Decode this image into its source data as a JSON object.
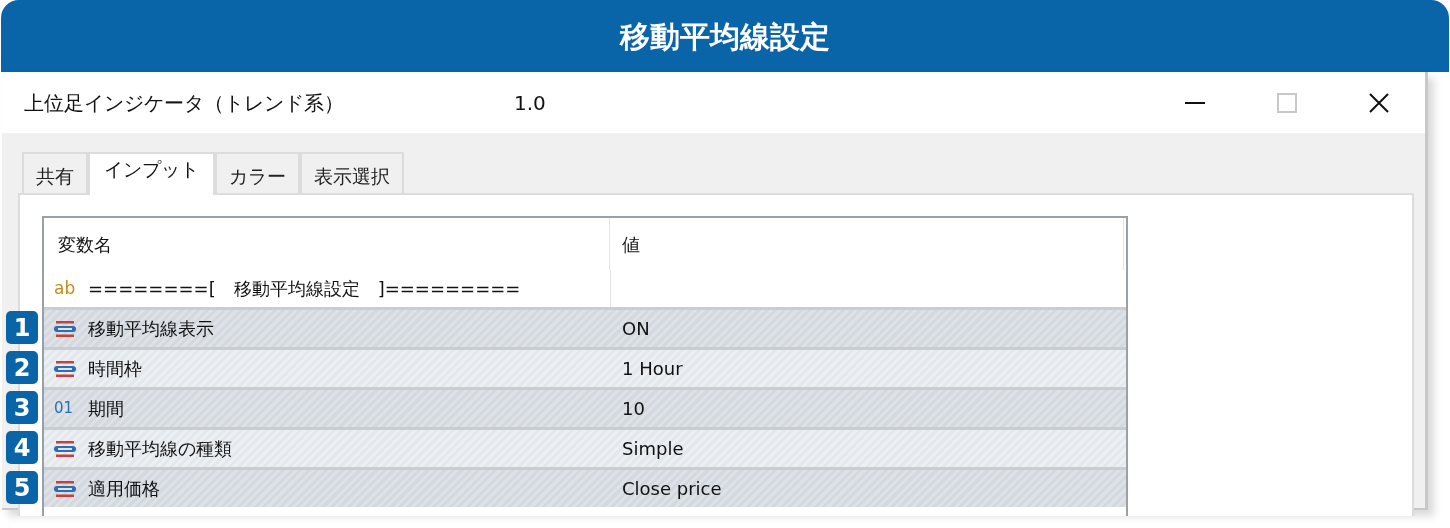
{
  "banner": {
    "title": "移動平均線設定"
  },
  "window": {
    "title": "上位足インジケータ（トレンド系）",
    "version": "1.0"
  },
  "tabs": [
    {
      "label": "共有",
      "selected": false
    },
    {
      "label": "インプット",
      "selected": true
    },
    {
      "label": "カラー",
      "selected": false
    },
    {
      "label": "表示選択",
      "selected": false
    }
  ],
  "table": {
    "columns": [
      "変数名",
      "値"
    ],
    "rows": [
      {
        "kind": "string",
        "type_label": "ab",
        "name": "========[　移動平均線設定　]========="
      },
      {
        "kind": "enum",
        "badge": "1",
        "name": "移動平均線表示",
        "value": "ON"
      },
      {
        "kind": "enum",
        "badge": "2",
        "name": "時間枠",
        "value": "1 Hour"
      },
      {
        "kind": "int",
        "badge": "3",
        "type_label": "01",
        "name": "期間",
        "value": "10"
      },
      {
        "kind": "enum",
        "badge": "4",
        "name": "移動平均線の種類",
        "value": "Simple"
      },
      {
        "kind": "enum",
        "badge": "5",
        "name": "適用価格",
        "value": "Close price"
      }
    ]
  }
}
